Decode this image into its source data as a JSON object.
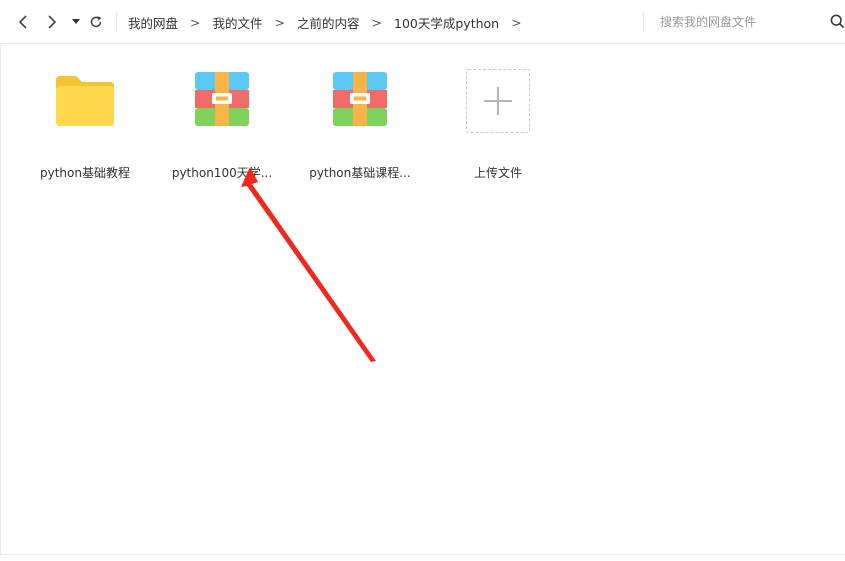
{
  "toolbar": {
    "back_icon": "chevron-left-icon",
    "forward_icon": "chevron-right-icon",
    "history_icon": "caret-down-icon",
    "refresh_icon": "refresh-icon"
  },
  "breadcrumb": {
    "items": [
      "我的网盘",
      "我的文件",
      "之前的内容",
      "100天学成python"
    ],
    "separator": ">"
  },
  "search": {
    "placeholder": "搜索我的网盘文件",
    "value": ""
  },
  "files": [
    {
      "name": "python基础教程",
      "type": "folder"
    },
    {
      "name": "python100天学...",
      "type": "archive"
    },
    {
      "name": "python基础课程...",
      "type": "archive"
    }
  ],
  "upload": {
    "label": "上传文件"
  },
  "colors": {
    "folder": "#FFD24D",
    "folder_tab": "#F5C232",
    "archive_blue": "#5BC8F5",
    "archive_red": "#F26B6B",
    "archive_green": "#7ED35A",
    "archive_strap": "#F7B548",
    "annotation_arrow": "#F0281E"
  }
}
